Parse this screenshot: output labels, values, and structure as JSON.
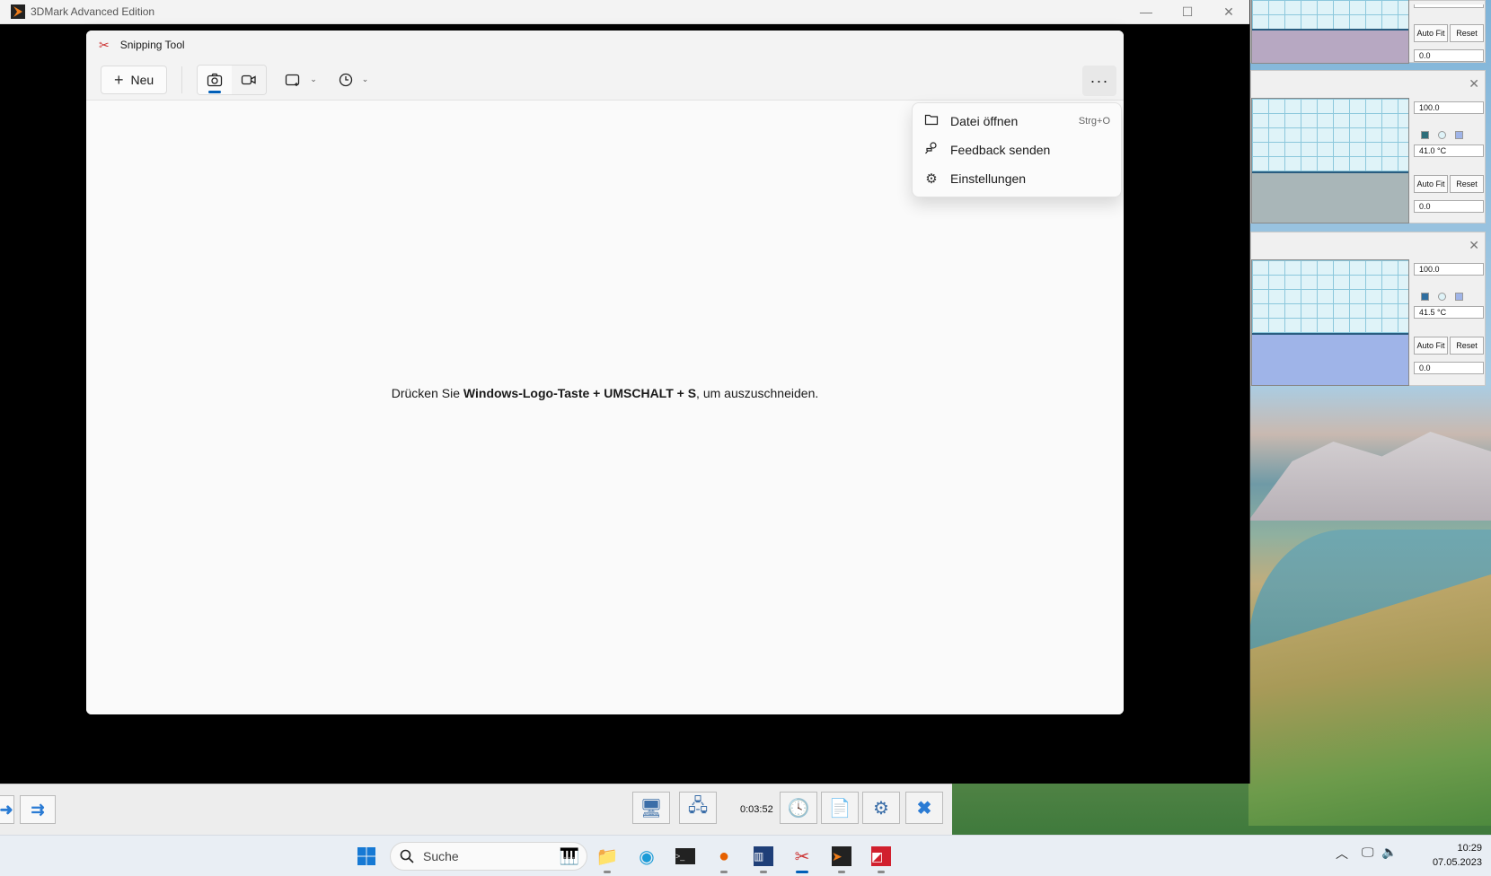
{
  "tdmark": {
    "title": "3DMark Advanced Edition",
    "controls": {
      "minimize": "—",
      "maximize": "☐",
      "close": "✕"
    },
    "bottom_bar": {
      "elapsed": "0:03:52"
    }
  },
  "snipping_tool": {
    "title": "Snipping Tool",
    "new_button": "Neu",
    "more_label": "···",
    "hint_prefix": "Drücken Sie ",
    "hint_bold": "Windows-Logo-Taste + UMSCHALT + S",
    "hint_suffix": ", um auszuschneiden.",
    "menu": [
      {
        "label": "Datei öffnen",
        "shortcut": "Strg+O",
        "icon": "folder-icon"
      },
      {
        "label": "Feedback senden",
        "shortcut": "",
        "icon": "feedback-icon"
      },
      {
        "label": "Einstellungen",
        "shortcut": "",
        "icon": "gear-icon"
      }
    ]
  },
  "monitor_panels": [
    {
      "max": "",
      "current": "",
      "min": "0.0",
      "auto_fit": "Auto Fit",
      "reset": "Reset",
      "fill_fraction": 0.55,
      "fill_color": "#b7a8c2"
    },
    {
      "max": "100.0",
      "current": "41.0 °C",
      "min": "0.0",
      "auto_fit": "Auto Fit",
      "reset": "Reset",
      "fill_fraction": 0.41,
      "fill_color": "#a9b6b8"
    },
    {
      "max": "100.0",
      "current": "41.5 °C",
      "min": "0.0",
      "auto_fit": "Auto Fit",
      "reset": "Reset",
      "fill_fraction": 0.415,
      "fill_color": "#9fb4e8"
    }
  ],
  "taskbar": {
    "search_placeholder": "Suche",
    "time": "10:29",
    "date": "07.05.2023"
  }
}
